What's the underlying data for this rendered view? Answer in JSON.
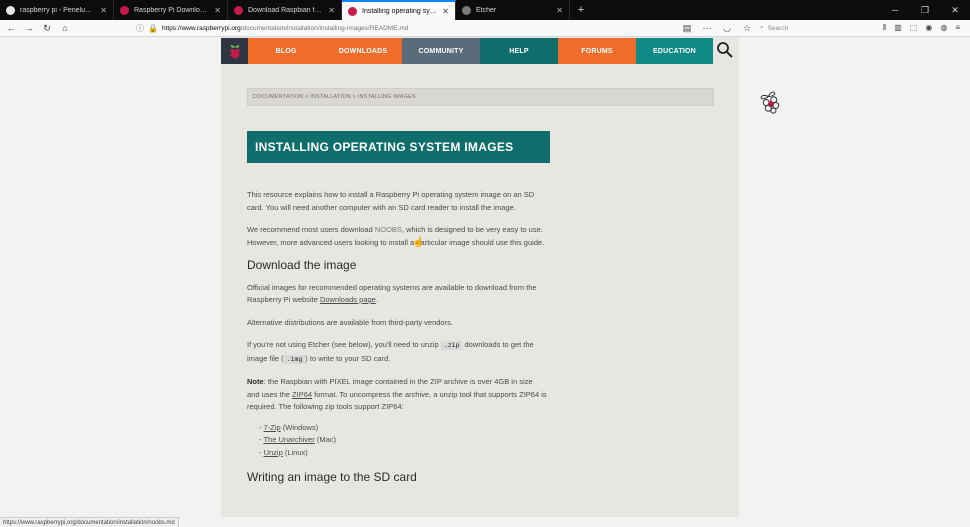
{
  "tabs": [
    {
      "title": "raspberry pi - Penelusuran Goo",
      "icon": "google-icon",
      "color": "#e8e8e8"
    },
    {
      "title": "Raspberry Pi Downloads - Sof",
      "icon": "raspberry-icon",
      "color": "#c51a4a"
    },
    {
      "title": "Download Raspbian for Raspb",
      "icon": "raspberry-icon",
      "color": "#c51a4a"
    },
    {
      "title": "Installing operating system im",
      "icon": "raspberry-icon",
      "color": "#c51a4a",
      "active": true
    },
    {
      "title": "Etcher",
      "icon": "etcher-icon",
      "color": "#7a7a7a"
    }
  ],
  "window_controls": [
    "─",
    "❐",
    "✕"
  ],
  "navbar": {
    "url_host": "https://www.raspberrypi.org",
    "url_path": "/documentation/installation/installing-images/README.md",
    "search_placeholder": "Search"
  },
  "site_nav": [
    {
      "label": "BLOG",
      "color": "#f06c2b"
    },
    {
      "label": "DOWNLOADS",
      "color": "#f06c2b"
    },
    {
      "label": "COMMUNITY",
      "color": "#5a6c7a"
    },
    {
      "label": "HELP",
      "color": "#0f6e6c"
    },
    {
      "label": "FORUMS",
      "color": "#f06c2b"
    },
    {
      "label": "EDUCATION",
      "color": "#0f8a86"
    }
  ],
  "breadcrumb": "DOCUMENTATION > INSTALLATION > INSTALLING IMAGES",
  "page_title": "INSTALLING OPERATING SYSTEM IMAGES",
  "intro": "This resource explains how to install a Raspberry Pi operating system image on an SD card. You will need another computer with an SD card reader to install the image.",
  "recommend": {
    "before": "We recommend most users download ",
    "link": "NOOBS",
    "after": ", which is designed to be very easy to use. However, more advanced users looking to install a particular image should use this guide."
  },
  "section1_title": "Download the image",
  "official": {
    "before": "Official images for recommended operating systems are available to download from the Raspberry Pi website ",
    "link": "Downloads page",
    "after": "."
  },
  "alternative": "Alternative distributions are available from third-party vendors.",
  "unzip": {
    "before": "If you're not using Etcher (see below), you'll need to unzip ",
    "code1": ".zip",
    "middle": " downloads to get the image file (",
    "code2": ".img",
    "after": ") to write to your SD card."
  },
  "note": {
    "label": "Note",
    "before": ": the Raspbian with PIXEL image contained in the ZIP archive is over 4GB in size and uses the ",
    "link": "ZIP64",
    "after": " format. To uncompress the archive, a unzip tool that supports ZIP64 is required. The following zip tools support ZIP64:"
  },
  "zip_tools": [
    {
      "name": "7-Zip",
      "os": " (Windows)"
    },
    {
      "name": "The Unarchiver",
      "os": " (Mac)"
    },
    {
      "name": "Unzip",
      "os": " (Linux)"
    }
  ],
  "section2_title": "Writing an image to the SD card",
  "status_url": "https://www.raspberrypi.org/documentation/installation/noobs.md"
}
